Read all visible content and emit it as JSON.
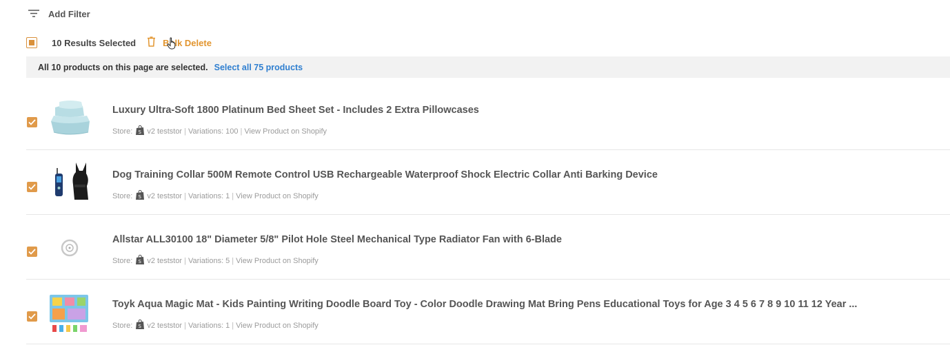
{
  "filter": {
    "label": "Add Filter"
  },
  "bulk": {
    "selected_text": "10 Results Selected",
    "delete_label": "Bulk Delete"
  },
  "banner": {
    "text": "All 10 products on this page are selected.",
    "link": "Select all 75 products"
  },
  "colors": {
    "accent": "#e09a4a",
    "link": "#2f7fd0",
    "banner_bg": "#f2f2f2"
  },
  "products": [
    {
      "title": "Luxury Ultra-Soft 1800 Platinum Bed Sheet Set - Includes 2 Extra Pillowcases",
      "store_label": "Store:",
      "store": "v2 teststor",
      "variations": "Variations: 100",
      "link": "View Product on Shopify",
      "checked": true,
      "thumb_icon": "bedsheet-image"
    },
    {
      "title": "Dog Training Collar 500M Remote Control USB Rechargeable Waterproof Shock Electric Collar Anti Barking Device",
      "store_label": "Store:",
      "store": "v2 teststor",
      "variations": "Variations: 1",
      "link": "View Product on Shopify",
      "checked": true,
      "thumb_icon": "dog-collar-image"
    },
    {
      "title": "Allstar ALL30100 18\" Diameter 5/8\" Pilot Hole Steel Mechanical Type Radiator Fan with 6-Blade",
      "store_label": "Store:",
      "store": "v2 teststor",
      "variations": "Variations: 5",
      "link": "View Product on Shopify",
      "checked": true,
      "thumb_icon": "fan-image"
    },
    {
      "title": "Toyk Aqua Magic Mat - Kids Painting Writing Doodle Board Toy - Color Doodle Drawing Mat Bring Pens Educational Toys for Age 3 4 5 6 7 8 9 10 11 12 Year ...",
      "store_label": "Store:",
      "store": "v2 teststor",
      "variations": "Variations: 1",
      "link": "View Product on Shopify",
      "checked": true,
      "thumb_icon": "doodle-mat-image"
    }
  ]
}
